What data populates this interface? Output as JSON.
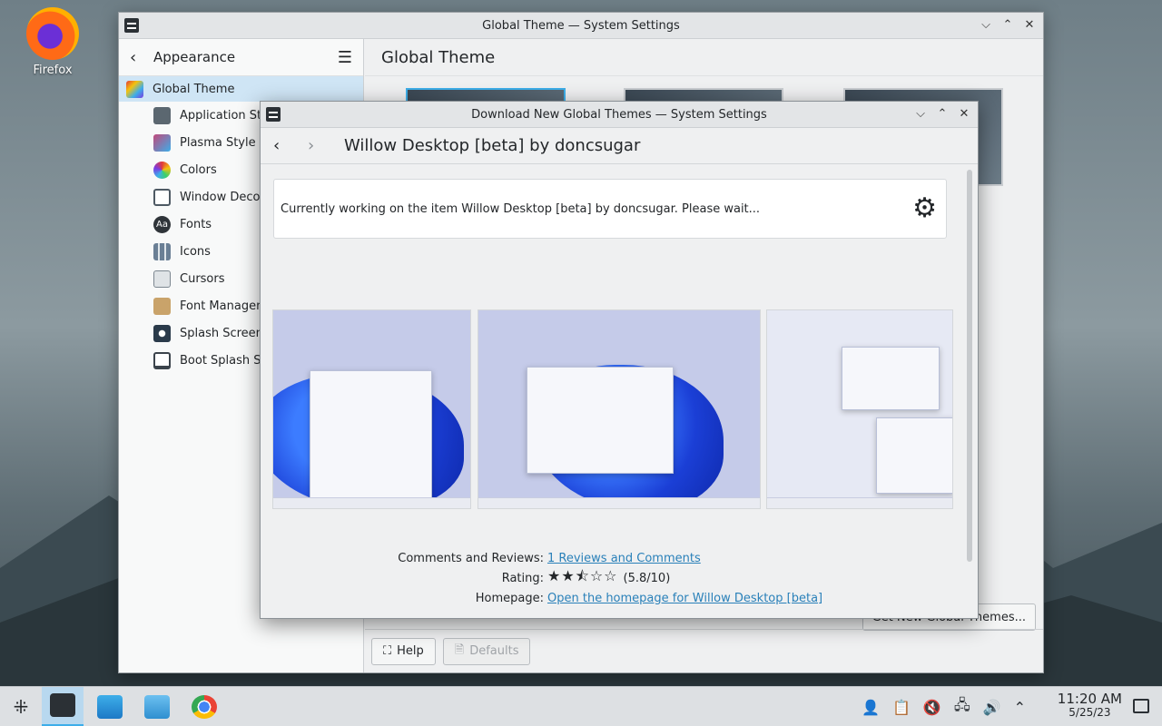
{
  "desktop": {
    "icon_label": "Firefox"
  },
  "main_window": {
    "title": "Global Theme — System Settings",
    "sidebar": {
      "back_label": "Appearance",
      "top_item": "Global Theme",
      "items": [
        {
          "label": "Application Sty",
          "color": "#5b6770"
        },
        {
          "label": "Plasma Style",
          "color": "#c2487a"
        },
        {
          "label": "Colors",
          "color": "#e8b10e"
        },
        {
          "label": "Window Decor",
          "color": "#4e5a64"
        },
        {
          "label": "Fonts",
          "color": "#2f3439"
        },
        {
          "label": "Icons",
          "color": "#6a7f95"
        },
        {
          "label": "Cursors",
          "color": "#7c8790"
        },
        {
          "label": "Font Managen",
          "color": "#c9a36a"
        },
        {
          "label": "Splash Screen",
          "color": "#2a3a4a"
        },
        {
          "label": "Boot Splash Sc",
          "color": "#3c444c"
        }
      ]
    },
    "content_title": "Global Theme",
    "get_new_button": "Get New Global Themes...",
    "help_button": "Help",
    "defaults_button": "Defaults"
  },
  "dialog": {
    "title": "Download New Global Themes — System Settings",
    "heading": "Willow Desktop [beta] by doncsugar",
    "status_text": "Currently working on the item Willow Desktop [beta] by doncsugar. Please wait...",
    "comments_label": "Comments and Reviews:",
    "comments_link": "1 Reviews and Comments",
    "rating_label": "Rating:",
    "rating_stars": "★★⯪☆☆",
    "rating_value": "(5.8/10)",
    "homepage_label": "Homepage:",
    "homepage_link": "Open the homepage for Willow Desktop [beta]"
  },
  "taskbar": {
    "time": "11:20 AM",
    "date": "5/25/23"
  },
  "colors": {
    "accent": "#3daee9",
    "selection": "#cfe5f5",
    "link": "#2980b9"
  }
}
